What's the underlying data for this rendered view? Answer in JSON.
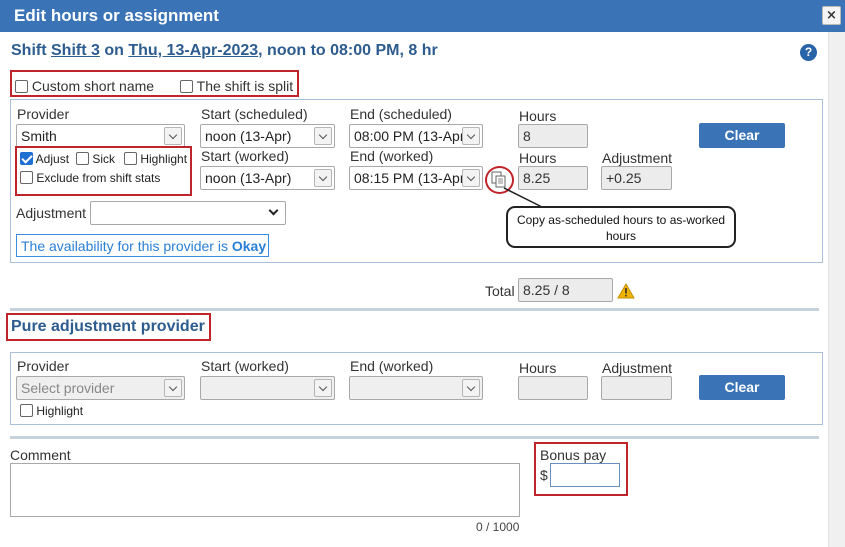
{
  "dialog": {
    "title": "Edit hours or assignment",
    "close_symbol": "×"
  },
  "shift": {
    "prefix": "Shift",
    "name": "Shift 3",
    "on": "on",
    "date": "Thu, 13-Apr-2023",
    "rest": ", noon to 08:00 PM, 8 hr"
  },
  "help_symbol": "?",
  "options": {
    "custom_short_name": "Custom short name",
    "shift_split": "The shift is split"
  },
  "assignment": {
    "provider_label": "Provider",
    "provider_value": "Smith",
    "start_scheduled_label": "Start (scheduled)",
    "start_scheduled_value": "noon (13-Apr)",
    "end_scheduled_label": "End (scheduled)",
    "end_scheduled_value": "08:00 PM (13-Apr",
    "hours_label": "Hours",
    "hours_scheduled_value": "8",
    "clear_label": "Clear",
    "adjust_label": "Adjust",
    "sick_label": "Sick",
    "highlight_label": "Highlight",
    "exclude_label": "Exclude from shift stats",
    "start_worked_label": "Start (worked)",
    "start_worked_value": "noon (13-Apr)",
    "end_worked_label": "End (worked)",
    "end_worked_value": "08:15 PM (13-Apr",
    "hours_worked_label": "Hours",
    "hours_worked_value": "8.25",
    "adjustment_label": "Adjustment",
    "adjustment_value": "+0.25",
    "adjustment_select_label": "Adjustment",
    "availability_text": "The availability for this provider is ",
    "availability_status": "Okay",
    "copy_callout": "Copy as-scheduled hours to as-worked hours"
  },
  "total": {
    "label": "Total",
    "value": "8.25 / 8"
  },
  "pure": {
    "title": "Pure adjustment provider",
    "provider_label": "Provider",
    "provider_placeholder": "Select provider",
    "start_label": "Start (worked)",
    "end_label": "End (worked)",
    "hours_label": "Hours",
    "adjustment_label": "Adjustment",
    "clear_label": "Clear",
    "highlight_label": "Highlight"
  },
  "comment": {
    "label": "Comment",
    "counter": "0 / 1000"
  },
  "bonus": {
    "label": "Bonus pay",
    "currency": "$"
  },
  "colors": {
    "title_bar": "#3a73b6",
    "accent_blue": "#2d5c8f",
    "highlight_red": "#c0242b",
    "warning": "#f0b400"
  }
}
